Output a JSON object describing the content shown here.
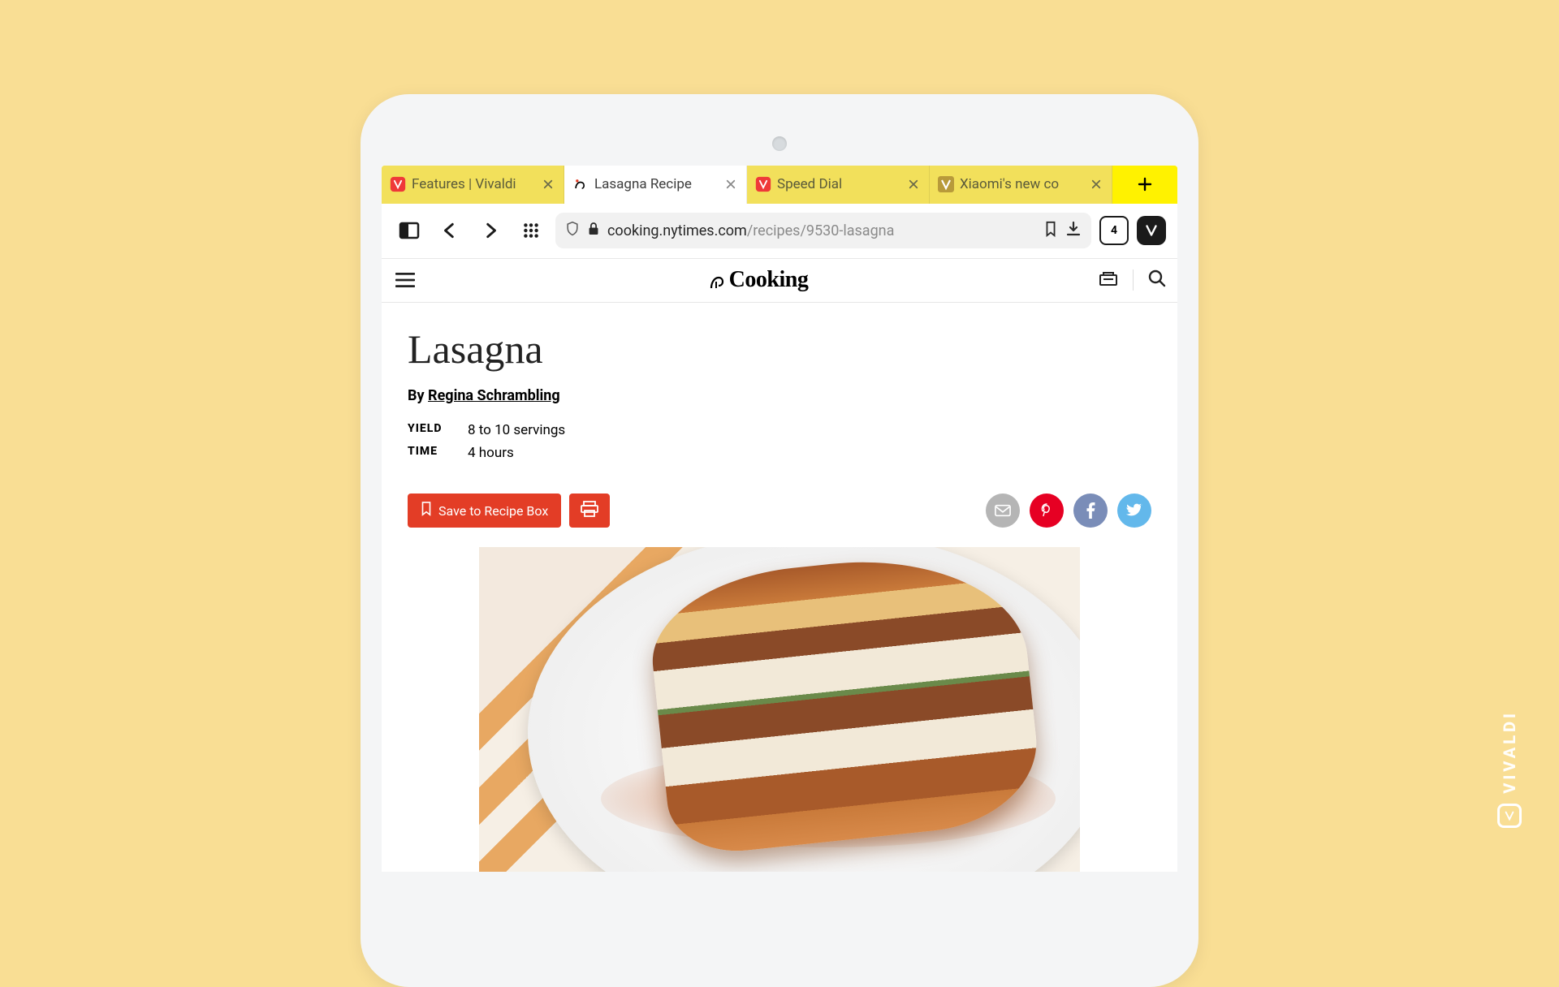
{
  "browser": {
    "tabs": [
      {
        "title": "Features | Vivaldi",
        "active": false,
        "favicon": "vivaldi"
      },
      {
        "title": "Lasagna Recipe",
        "active": true,
        "favicon": "nyt"
      },
      {
        "title": "Speed Dial",
        "active": false,
        "favicon": "vivaldi"
      },
      {
        "title": "Xiaomi's new co",
        "active": false,
        "favicon": "verge"
      }
    ],
    "tab_count": "4",
    "url_host": "cooking.nytimes.com",
    "url_path": "/recipes/9530-lasagna"
  },
  "site": {
    "brand": "Cooking"
  },
  "recipe": {
    "title": "Lasagna",
    "byline_prefix": "By",
    "author": "Regina Schrambling",
    "yield_label": "YIELD",
    "yield_value": "8 to 10 servings",
    "time_label": "TIME",
    "time_value": "4 hours",
    "save_label": "Save to Recipe Box"
  },
  "watermark": "VIVALDI"
}
